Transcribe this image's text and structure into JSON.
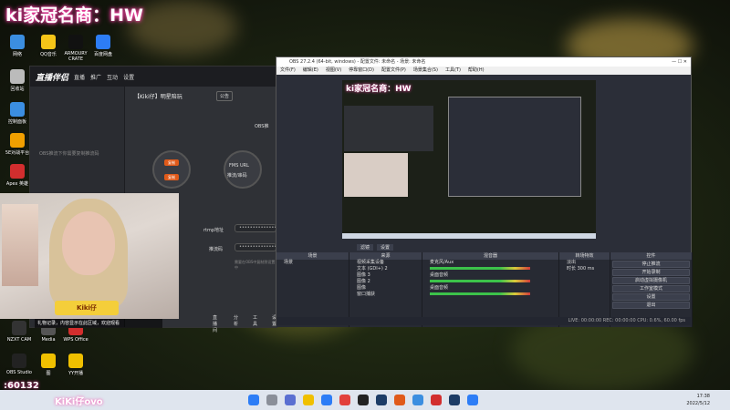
{
  "banner": {
    "text": "ki家冠名商：HW"
  },
  "desktop_icons": [
    {
      "label": "网络",
      "color": "#3b8ee0"
    },
    {
      "label": "QQ音乐",
      "color": "#f5c518"
    },
    {
      "label": "ARMOURY CRATE",
      "color": "#111111"
    },
    {
      "label": "百度网盘",
      "color": "#2d7df6"
    },
    {
      "label": "回收站",
      "color": "#bbbbbb"
    },
    {
      "label": "控制面板",
      "color": "#3b8ee0"
    },
    {
      "label": "5E对战平台",
      "color": "#f0a000"
    },
    {
      "label": "Apex 英雄",
      "color": "#d22e2e"
    },
    {
      "label": "NZXT CAM",
      "color": "#333333"
    },
    {
      "label": "Media",
      "color": "#555555"
    },
    {
      "label": "WPS Office",
      "color": "#d22e2e"
    },
    {
      "label": "OBS Studio",
      "color": "#222222"
    },
    {
      "label": "图",
      "color": "#f0c000"
    },
    {
      "label": "YY开播",
      "color": "#f0c000"
    }
  ],
  "app": {
    "logo": "直播伴侣",
    "tabs": [
      "直播",
      "推广",
      "互动",
      "设置"
    ],
    "room_label": "【Kiki仔】明星陪玩",
    "room_tag": "公告",
    "left_hint": "OBS推流下你需要复制推流码",
    "obs_label": "OBS推",
    "push_btn": "复制",
    "push_btn2": "复制",
    "fms_label": "FMS URL",
    "fms_sub": "推流/串码",
    "server_label": "rtmp地址",
    "key_label": "推流码",
    "server_value": "••••••••••••••••",
    "key_value": "••••••••••••••••",
    "hint": "需要在OBS中复制到设置中",
    "bottom_items": [
      "直播间",
      "分析",
      "工具",
      "设置"
    ]
  },
  "webcam": {
    "badge": "Kiki仔"
  },
  "chat_text": "礼物记录，内容显示在此区域，欢迎观看",
  "obs": {
    "title": "OBS 27.2.4 (64-bit, windows) - 配置文件: 未命名 - 场景: 未命名",
    "menu": [
      "文件(F)",
      "编辑(E)",
      "视图(V)",
      "停靠窗口(D)",
      "配置文件(P)",
      "场景集合(S)",
      "工具(T)",
      "帮助(H)"
    ],
    "scene_tabs": [
      "滤镜",
      "设置"
    ],
    "docks": [
      {
        "title": "场景",
        "items": [
          "场景"
        ]
      },
      {
        "title": "来源",
        "items": [
          "视频采集设备",
          "文本 (GDI+) 2",
          "图像 3",
          "图像 2",
          "图像",
          "窗口捕获"
        ]
      },
      {
        "title": "混音器",
        "items": [
          "麦克风/Aux",
          "桌面音频",
          "桌面音频"
        ]
      },
      {
        "title": "转场特效",
        "items": [
          "淡出",
          "时长 300 ms"
        ]
      },
      {
        "title": "控件",
        "items": [
          "停止推流",
          "开始录制",
          "启动虚拟摄像机",
          "工作室模式",
          "设置",
          "退出"
        ]
      }
    ],
    "status": "LIVE: 00:00:00   REC: 00:00:00   CPU: 0.6%, 60.00 fps"
  },
  "bottom_strip": {
    "prefix": ":60132",
    "name": "KiKi仔ovo"
  },
  "taskbar": {
    "time": "17:38",
    "date": "2022/5/12"
  }
}
